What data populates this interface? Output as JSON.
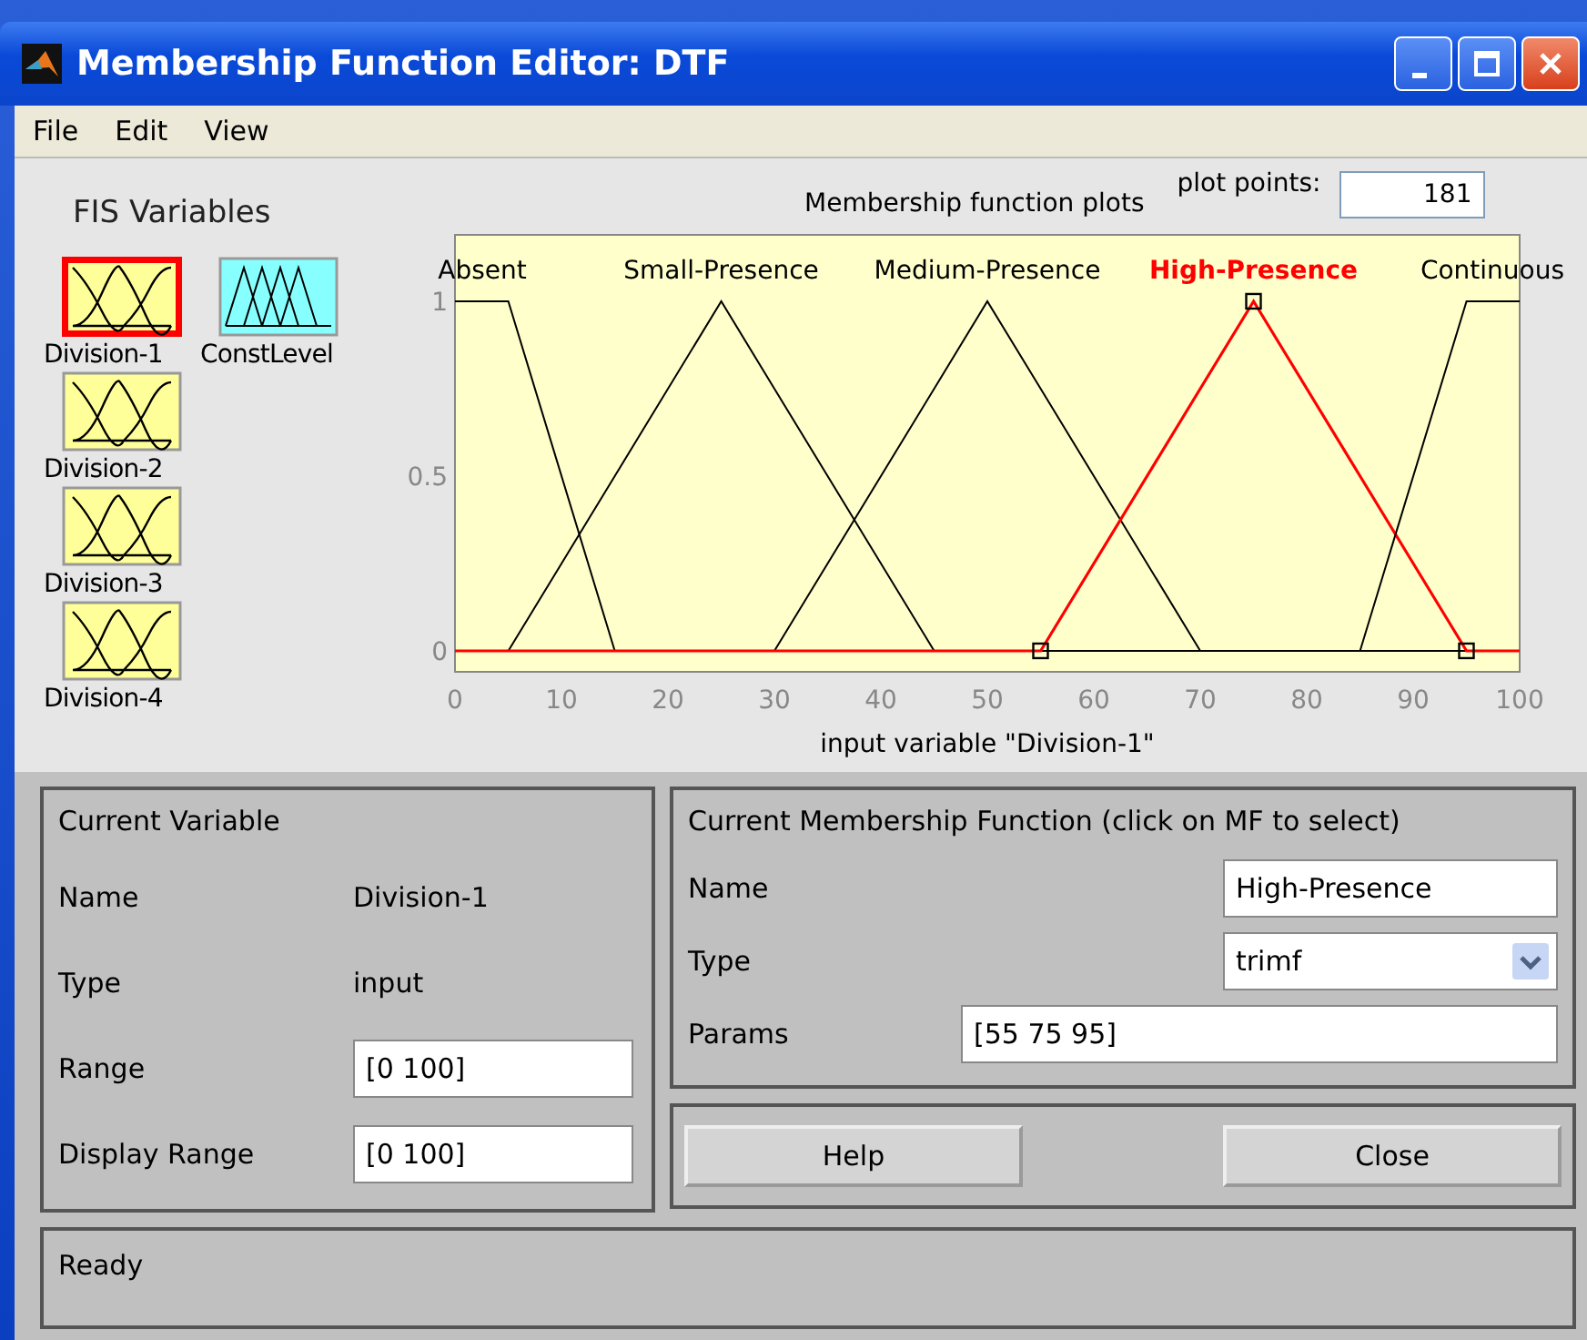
{
  "window": {
    "title": "Membership Function Editor: DTF"
  },
  "menu": [
    "File",
    "Edit",
    "View"
  ],
  "fis_variables": {
    "title": "FIS Variables",
    "items": [
      {
        "name": "Division-1",
        "kind": "input",
        "selected": true
      },
      {
        "name": "ConstLevel",
        "kind": "output",
        "selected": false
      },
      {
        "name": "Division-2",
        "kind": "input",
        "selected": false
      },
      {
        "name": "Division-3",
        "kind": "input",
        "selected": false
      },
      {
        "name": "Division-4",
        "kind": "input",
        "selected": false
      }
    ]
  },
  "plot": {
    "title": "Membership function plots",
    "plot_points_label": "plot points:",
    "plot_points": "181",
    "chart_data": {
      "type": "line",
      "xlabel": "input variable \"Division-1\"",
      "x": [
        0,
        5,
        15,
        25,
        30,
        45,
        50,
        55,
        70,
        75,
        85,
        95,
        100
      ],
      "xlim": [
        0,
        100
      ],
      "ylim": [
        -0.06,
        1.19
      ],
      "xticks": [
        0,
        10,
        20,
        30,
        40,
        50,
        60,
        70,
        80,
        90,
        100
      ],
      "yticks": [
        0,
        0.5,
        1
      ],
      "series": [
        {
          "name": "Absent",
          "color": "#000000",
          "values": [
            1,
            1,
            0,
            null,
            null,
            null,
            null,
            null,
            null,
            null,
            null,
            null,
            null
          ]
        },
        {
          "name": "Small-Presence",
          "color": "#000000",
          "values": [
            null,
            0,
            0.5,
            1,
            0.75,
            0,
            null,
            null,
            null,
            null,
            null,
            null,
            null
          ]
        },
        {
          "name": "Medium-Presence",
          "color": "#000000",
          "values": [
            null,
            null,
            null,
            null,
            0,
            0.75,
            1,
            0.75,
            0,
            null,
            null,
            null,
            null
          ]
        },
        {
          "name": "High-Presence",
          "color": "#ff0000",
          "values": [
            0,
            0,
            0,
            0,
            0,
            0,
            0,
            0,
            0.75,
            1,
            0.5,
            0,
            0
          ]
        },
        {
          "name": "Continuous",
          "color": "#000000",
          "values": [
            null,
            null,
            null,
            null,
            null,
            null,
            null,
            null,
            null,
            null,
            0,
            1,
            1
          ]
        }
      ]
    }
  },
  "current_variable": {
    "title": "Current Variable",
    "name_label": "Name",
    "name": "Division-1",
    "type_label": "Type",
    "type": "input",
    "range_label": "Range",
    "range": "[0 100]",
    "display_range_label": "Display Range",
    "display_range": "[0 100]"
  },
  "current_mf": {
    "title": "Current Membership Function (click on MF to select)",
    "name_label": "Name",
    "name": "High-Presence",
    "type_label": "Type",
    "type": "trimf",
    "params_label": "Params",
    "params": "[55 75 95]"
  },
  "buttons": [
    "Help",
    "Close"
  ],
  "status": "Ready"
}
